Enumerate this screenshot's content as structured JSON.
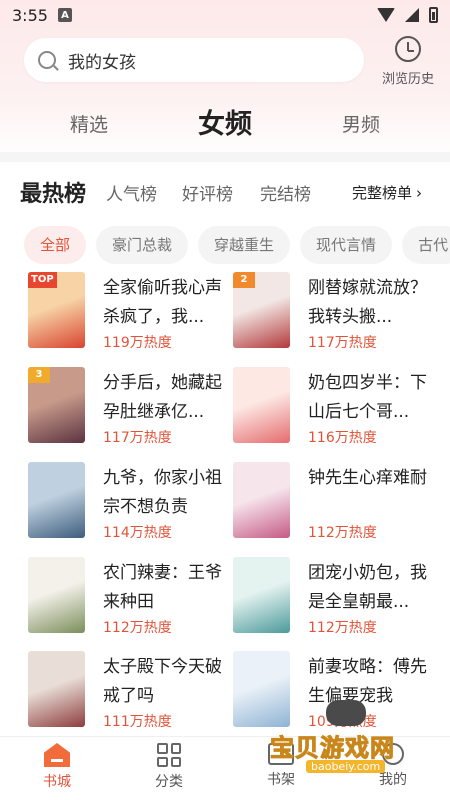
{
  "status": {
    "time": "3:55",
    "a_icon": "A"
  },
  "search": {
    "value": "我的女孩"
  },
  "history": {
    "label": "浏览历史"
  },
  "channels": [
    {
      "label": "精选"
    },
    {
      "label": "女频",
      "active": true
    },
    {
      "label": "男频"
    }
  ],
  "rank_tabs": [
    {
      "label": "最热榜",
      "active": true
    },
    {
      "label": "人气榜"
    },
    {
      "label": "好评榜"
    },
    {
      "label": "完结榜"
    }
  ],
  "full_list": {
    "label": "完整榜单",
    "chevron": "›"
  },
  "chips": [
    {
      "label": "全部",
      "active": true
    },
    {
      "label": "豪门总裁"
    },
    {
      "label": "穿越重生"
    },
    {
      "label": "现代言情"
    },
    {
      "label": "古代"
    }
  ],
  "books": [
    {
      "title": "全家偷听我心声杀疯了，我...",
      "heat": "119万热度",
      "badge": "TOP",
      "badge_color": "#e8462f",
      "cover_colors": [
        "#f7d3a6",
        "#d9442f"
      ]
    },
    {
      "title": "刚替嫁就流放？我转头搬...",
      "heat": "117万热度",
      "badge": "2",
      "badge_color": "#f08a2c",
      "cover_colors": [
        "#f2e7e4",
        "#b2383a"
      ]
    },
    {
      "title": "分手后，她藏起孕肚继承亿...",
      "heat": "117万热度",
      "badge": "3",
      "badge_color": "#f0aa2c",
      "cover_colors": [
        "#c79a8a",
        "#5b3340"
      ]
    },
    {
      "title": "奶包四岁半：下山后七个哥...",
      "heat": "116万热度",
      "badge": "",
      "badge_color": "",
      "cover_colors": [
        "#fde8e4",
        "#e46c6f"
      ]
    },
    {
      "title": "九爷，你家小祖宗不想负责",
      "heat": "114万热度",
      "badge": "",
      "badge_color": "",
      "cover_colors": [
        "#bfd0e0",
        "#3c5d7c"
      ]
    },
    {
      "title": "钟先生心痒难耐",
      "heat": "112万热度",
      "badge": "",
      "badge_color": "",
      "cover_colors": [
        "#f6e6ec",
        "#c55a86"
      ]
    },
    {
      "title": "农门辣妻：王爷来种田",
      "heat": "112万热度",
      "badge": "",
      "badge_color": "",
      "cover_colors": [
        "#f3f1ea",
        "#7b8e5a"
      ]
    },
    {
      "title": "团宠小奶包，我是全皇朝最...",
      "heat": "112万热度",
      "badge": "",
      "badge_color": "",
      "cover_colors": [
        "#e4f2f0",
        "#4c9a9a"
      ]
    },
    {
      "title": "太子殿下今天破戒了吗",
      "heat": "111万热度",
      "badge": "",
      "badge_color": "",
      "cover_colors": [
        "#e9ded7",
        "#8d3d3d"
      ]
    },
    {
      "title": "前妻攻略：傅先生偏要宠我",
      "heat": "109万热度",
      "badge": "",
      "badge_color": "",
      "cover_colors": [
        "#eaf1f8",
        "#8fb3d4"
      ]
    }
  ],
  "bottom_nav": [
    {
      "label": "书城",
      "active": true
    },
    {
      "label": "分类"
    },
    {
      "label": "书架"
    },
    {
      "label": "我的"
    }
  ],
  "watermark": {
    "text": "宝贝游戏网",
    "url": "baobeiy.com"
  },
  "colors": {
    "accent": "#e2543a",
    "home_icon": "#f26b3a",
    "header_bg": "#fde9ea"
  }
}
